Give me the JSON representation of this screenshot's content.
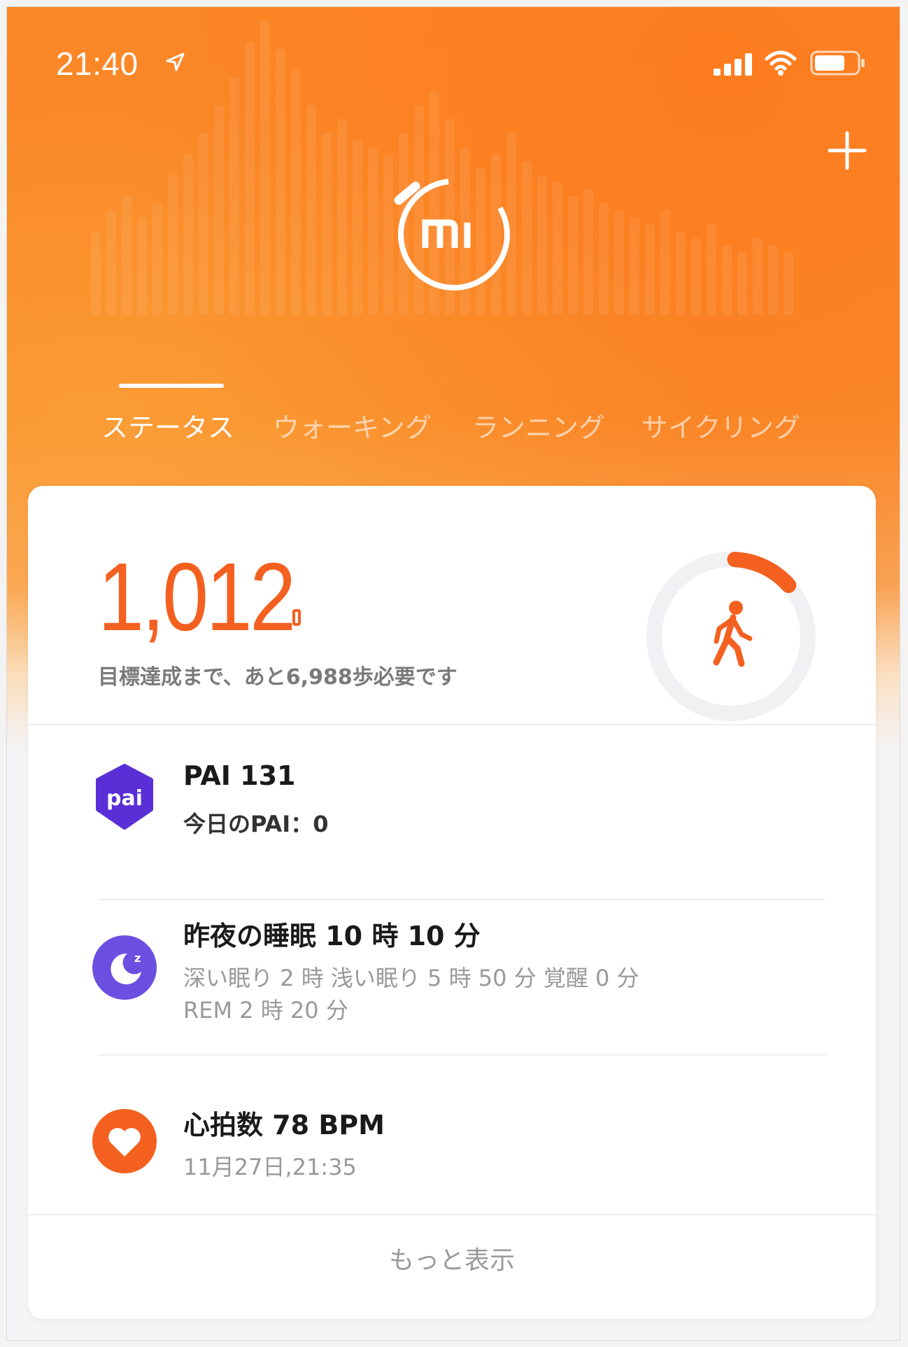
{
  "status_bar": {
    "time": "21:40",
    "icons": [
      "location-arrow-icon",
      "signal-icon",
      "wifi-icon",
      "battery-icon"
    ]
  },
  "header": {
    "logo_text": "mi",
    "add_icon": "plus-icon"
  },
  "tabs": [
    {
      "label": "ステータス",
      "active": true
    },
    {
      "label": "ウォーキング",
      "active": false
    },
    {
      "label": "ランニング",
      "active": false
    },
    {
      "label": "サイクリング",
      "active": false
    }
  ],
  "steps": {
    "value": "1,012",
    "goal_text": "目標達成まで、あと6,988歩必要です",
    "progress_fraction": 0.1265,
    "icon": "walking-person-icon"
  },
  "rows": [
    {
      "icon": "pai-icon",
      "icon_text": "pai",
      "title": "PAI 131",
      "subtitle": "今日のPAI：0"
    },
    {
      "icon": "sleep-moon-icon",
      "title": "昨夜の睡眠 10 時 10 分",
      "subtitle": "深い眠り 2 時  浅い眠り 5 時 50 分  覚醒 0 分",
      "subtitle2": "REM 2 時 20 分"
    },
    {
      "icon": "heart-icon",
      "title": "心拍数 78 BPM",
      "subtitle": "11月27日,21:35"
    }
  ],
  "more_button": "もっと表示",
  "colors": {
    "accent": "#f4601f",
    "hero_orange": "#fb8727",
    "pai_purple": "#5a2fd6",
    "sleep_purple": "#6b4fe0",
    "heart_orange": "#f4601f"
  }
}
